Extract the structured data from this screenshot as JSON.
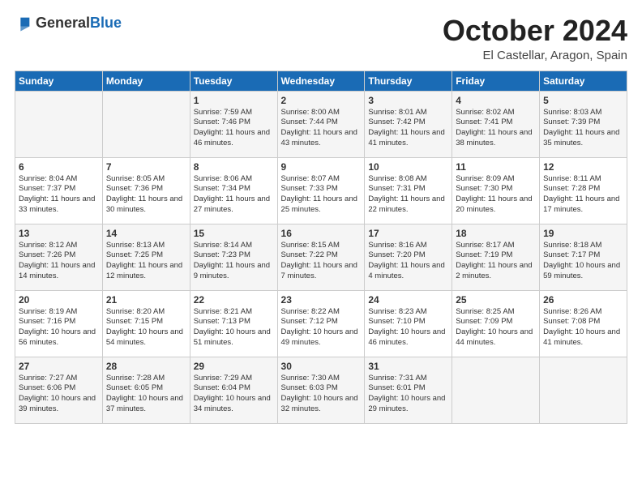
{
  "header": {
    "logo_general": "General",
    "logo_blue": "Blue",
    "title": "October 2024",
    "location": "El Castellar, Aragon, Spain"
  },
  "columns": [
    "Sunday",
    "Monday",
    "Tuesday",
    "Wednesday",
    "Thursday",
    "Friday",
    "Saturday"
  ],
  "weeks": [
    [
      {
        "day": "",
        "text": ""
      },
      {
        "day": "",
        "text": ""
      },
      {
        "day": "1",
        "text": "Sunrise: 7:59 AM\nSunset: 7:46 PM\nDaylight: 11 hours and 46 minutes."
      },
      {
        "day": "2",
        "text": "Sunrise: 8:00 AM\nSunset: 7:44 PM\nDaylight: 11 hours and 43 minutes."
      },
      {
        "day": "3",
        "text": "Sunrise: 8:01 AM\nSunset: 7:42 PM\nDaylight: 11 hours and 41 minutes."
      },
      {
        "day": "4",
        "text": "Sunrise: 8:02 AM\nSunset: 7:41 PM\nDaylight: 11 hours and 38 minutes."
      },
      {
        "day": "5",
        "text": "Sunrise: 8:03 AM\nSunset: 7:39 PM\nDaylight: 11 hours and 35 minutes."
      }
    ],
    [
      {
        "day": "6",
        "text": "Sunrise: 8:04 AM\nSunset: 7:37 PM\nDaylight: 11 hours and 33 minutes."
      },
      {
        "day": "7",
        "text": "Sunrise: 8:05 AM\nSunset: 7:36 PM\nDaylight: 11 hours and 30 minutes."
      },
      {
        "day": "8",
        "text": "Sunrise: 8:06 AM\nSunset: 7:34 PM\nDaylight: 11 hours and 27 minutes."
      },
      {
        "day": "9",
        "text": "Sunrise: 8:07 AM\nSunset: 7:33 PM\nDaylight: 11 hours and 25 minutes."
      },
      {
        "day": "10",
        "text": "Sunrise: 8:08 AM\nSunset: 7:31 PM\nDaylight: 11 hours and 22 minutes."
      },
      {
        "day": "11",
        "text": "Sunrise: 8:09 AM\nSunset: 7:30 PM\nDaylight: 11 hours and 20 minutes."
      },
      {
        "day": "12",
        "text": "Sunrise: 8:11 AM\nSunset: 7:28 PM\nDaylight: 11 hours and 17 minutes."
      }
    ],
    [
      {
        "day": "13",
        "text": "Sunrise: 8:12 AM\nSunset: 7:26 PM\nDaylight: 11 hours and 14 minutes."
      },
      {
        "day": "14",
        "text": "Sunrise: 8:13 AM\nSunset: 7:25 PM\nDaylight: 11 hours and 12 minutes."
      },
      {
        "day": "15",
        "text": "Sunrise: 8:14 AM\nSunset: 7:23 PM\nDaylight: 11 hours and 9 minutes."
      },
      {
        "day": "16",
        "text": "Sunrise: 8:15 AM\nSunset: 7:22 PM\nDaylight: 11 hours and 7 minutes."
      },
      {
        "day": "17",
        "text": "Sunrise: 8:16 AM\nSunset: 7:20 PM\nDaylight: 11 hours and 4 minutes."
      },
      {
        "day": "18",
        "text": "Sunrise: 8:17 AM\nSunset: 7:19 PM\nDaylight: 11 hours and 2 minutes."
      },
      {
        "day": "19",
        "text": "Sunrise: 8:18 AM\nSunset: 7:17 PM\nDaylight: 10 hours and 59 minutes."
      }
    ],
    [
      {
        "day": "20",
        "text": "Sunrise: 8:19 AM\nSunset: 7:16 PM\nDaylight: 10 hours and 56 minutes."
      },
      {
        "day": "21",
        "text": "Sunrise: 8:20 AM\nSunset: 7:15 PM\nDaylight: 10 hours and 54 minutes."
      },
      {
        "day": "22",
        "text": "Sunrise: 8:21 AM\nSunset: 7:13 PM\nDaylight: 10 hours and 51 minutes."
      },
      {
        "day": "23",
        "text": "Sunrise: 8:22 AM\nSunset: 7:12 PM\nDaylight: 10 hours and 49 minutes."
      },
      {
        "day": "24",
        "text": "Sunrise: 8:23 AM\nSunset: 7:10 PM\nDaylight: 10 hours and 46 minutes."
      },
      {
        "day": "25",
        "text": "Sunrise: 8:25 AM\nSunset: 7:09 PM\nDaylight: 10 hours and 44 minutes."
      },
      {
        "day": "26",
        "text": "Sunrise: 8:26 AM\nSunset: 7:08 PM\nDaylight: 10 hours and 41 minutes."
      }
    ],
    [
      {
        "day": "27",
        "text": "Sunrise: 7:27 AM\nSunset: 6:06 PM\nDaylight: 10 hours and 39 minutes."
      },
      {
        "day": "28",
        "text": "Sunrise: 7:28 AM\nSunset: 6:05 PM\nDaylight: 10 hours and 37 minutes."
      },
      {
        "day": "29",
        "text": "Sunrise: 7:29 AM\nSunset: 6:04 PM\nDaylight: 10 hours and 34 minutes."
      },
      {
        "day": "30",
        "text": "Sunrise: 7:30 AM\nSunset: 6:03 PM\nDaylight: 10 hours and 32 minutes."
      },
      {
        "day": "31",
        "text": "Sunrise: 7:31 AM\nSunset: 6:01 PM\nDaylight: 10 hours and 29 minutes."
      },
      {
        "day": "",
        "text": ""
      },
      {
        "day": "",
        "text": ""
      }
    ]
  ]
}
